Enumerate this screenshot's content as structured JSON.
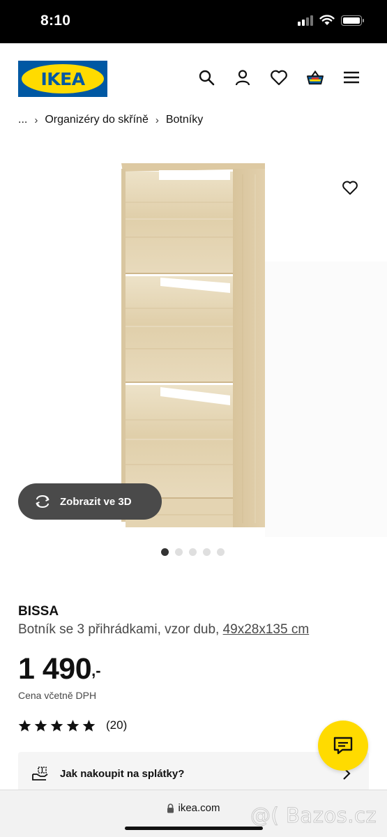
{
  "status_bar": {
    "time": "8:10"
  },
  "header": {
    "logo_text": "IKEA",
    "icons": [
      "search-icon",
      "user-icon",
      "heart-icon",
      "cart-icon",
      "menu-icon"
    ]
  },
  "breadcrumb": {
    "ellipsis": "...",
    "separator": "›",
    "items": [
      "Organizéry do skříně",
      "Botníky"
    ]
  },
  "gallery": {
    "view_3d_label": "Zobrazit ve 3D",
    "total_images": 5,
    "active_index": 0
  },
  "product": {
    "name": "BISSA",
    "description": "Botník se 3 přihrádkami, vzor dub, ",
    "dimensions": "49x28x135 cm",
    "price": "1 490",
    "price_suffix": ",-",
    "price_note": "Cena včetně DPH",
    "rating_stars": 5,
    "rating_count": "(20)"
  },
  "installment": {
    "label": "Jak nakoupit na splátky?"
  },
  "browser": {
    "url": "ikea.com"
  },
  "watermark": {
    "text": "@( Bazos.cz"
  },
  "colors": {
    "ikea_blue": "#0058a3",
    "ikea_yellow": "#ffdb00",
    "button_dark": "#4a4a4a",
    "wood_light": "#e8d9ba",
    "wood_mid": "#dcc9a4"
  }
}
